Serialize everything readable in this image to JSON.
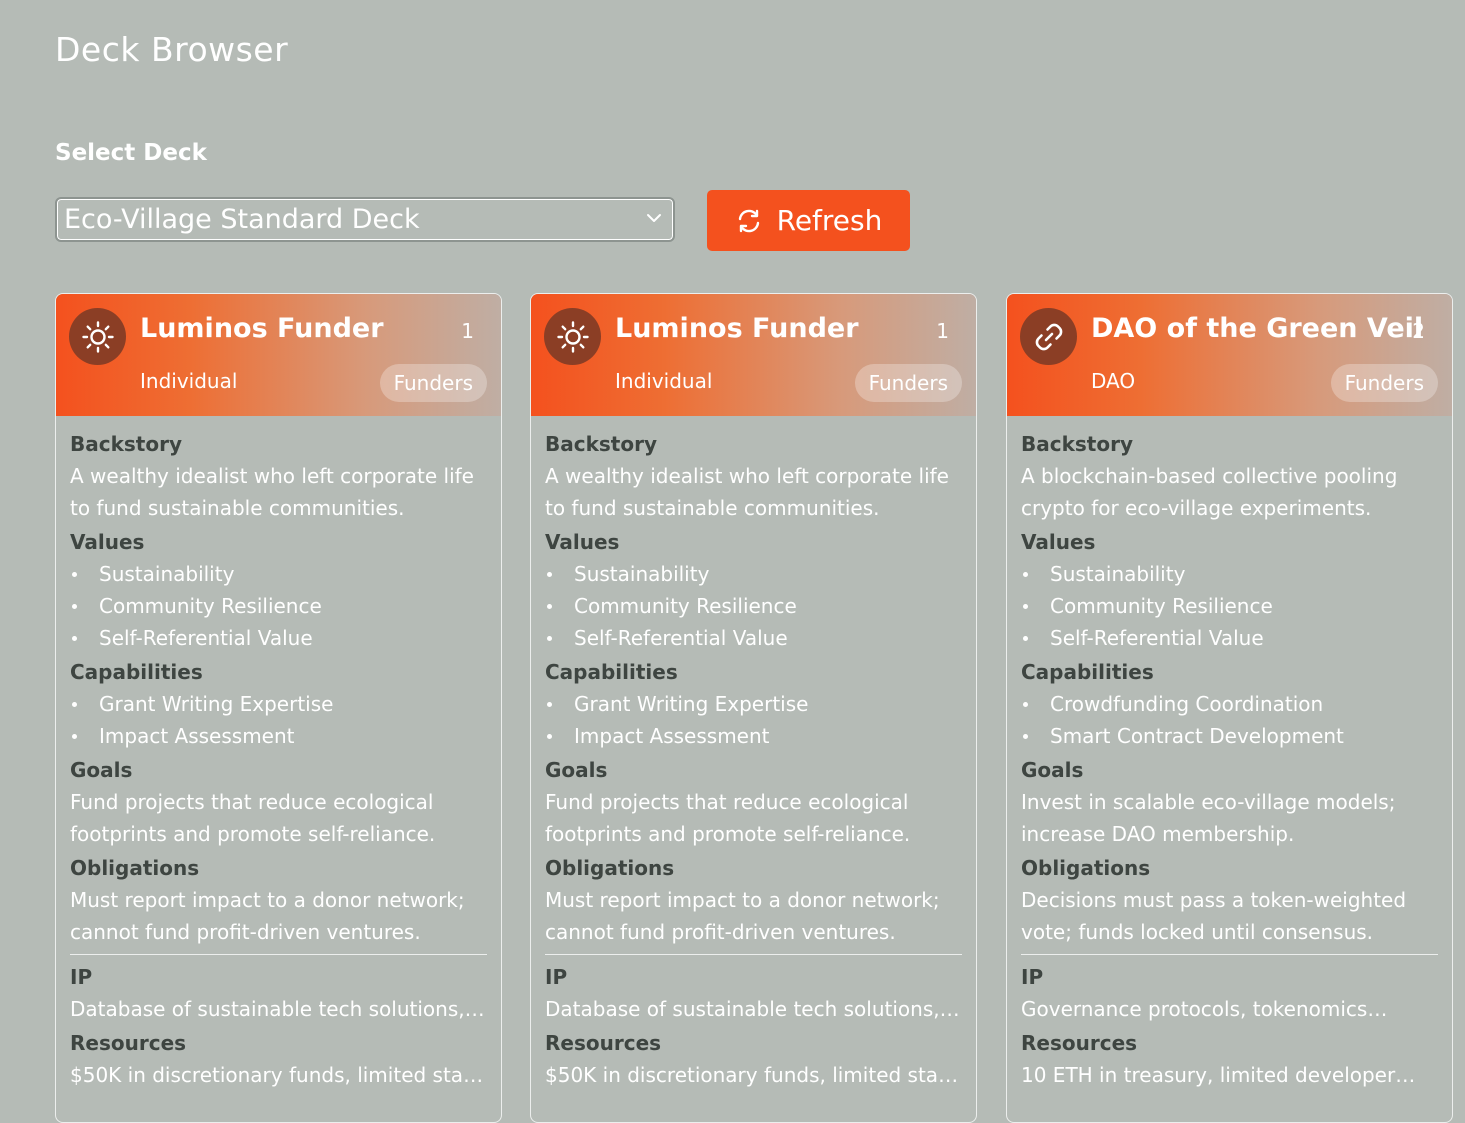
{
  "page": {
    "title": "Deck Browser",
    "select_label": "Select Deck"
  },
  "deck_select": {
    "value": "Eco-Village Standard Deck"
  },
  "refresh_button": {
    "label": "Refresh",
    "icon": "refresh-icon",
    "color": "#f4511e"
  },
  "labels": {
    "backstory": "Backstory",
    "values": "Values",
    "capabilities": "Capabilities",
    "goals": "Goals",
    "obligations": "Obligations",
    "ip": "IP",
    "resources": "Resources"
  },
  "cards": [
    {
      "name": "Luminos Funder",
      "count": "1",
      "type": "Individual",
      "badge": "Funders",
      "icon": "sun-icon",
      "backstory": "A wealthy idealist who left corporate life to fund sustainable communities.",
      "values": [
        "Sustainability",
        "Community Resilience",
        "Self-Referential Value"
      ],
      "capabilities": [
        "Grant Writing Expertise",
        "Impact Assessment"
      ],
      "goals": "Fund projects that reduce ecological footprints and promote self-reliance.",
      "obligations": "Must report impact to a donor network; cannot fund profit-driven ventures.",
      "ip": "Database of sustainable tech solutions,…",
      "resources": "$50K in discretionary funds, limited staf…"
    },
    {
      "name": "Luminos Funder",
      "count": "1",
      "type": "Individual",
      "badge": "Funders",
      "icon": "sun-icon",
      "backstory": "A wealthy idealist who left corporate life to fund sustainable communities.",
      "values": [
        "Sustainability",
        "Community Resilience",
        "Self-Referential Value"
      ],
      "capabilities": [
        "Grant Writing Expertise",
        "Impact Assessment"
      ],
      "goals": "Fund projects that reduce ecological footprints and promote self-reliance.",
      "obligations": "Must report impact to a donor network; cannot fund profit-driven ventures.",
      "ip": "Database of sustainable tech solutions,…",
      "resources": "$50K in discretionary funds, limited staf…"
    },
    {
      "name": "DAO of the Green Veil",
      "count": "2",
      "type": "DAO",
      "badge": "Funders",
      "icon": "link-icon",
      "backstory": "A blockchain-based collective pooling crypto for eco-village experiments.",
      "values": [
        "Sustainability",
        "Community Resilience",
        "Self-Referential Value"
      ],
      "capabilities": [
        "Crowdfunding Coordination",
        "Smart Contract Development"
      ],
      "goals": "Invest in scalable eco-village models; increase DAO membership.",
      "obligations": "Decisions must pass a token-weighted vote; funds locked until consensus.",
      "ip": "Governance protocols, tokenomics…",
      "resources": "10 ETH in treasury, limited developer…"
    }
  ]
}
